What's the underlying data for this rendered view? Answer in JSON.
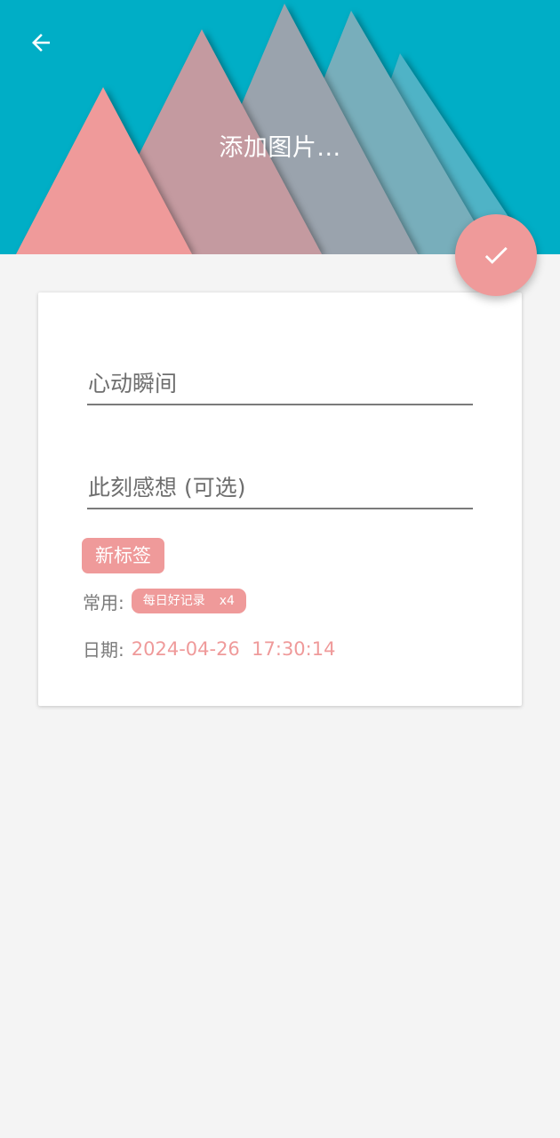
{
  "header": {
    "title": "添加图片...",
    "background_color": "#00aec6"
  },
  "icons": {
    "back": "arrow-left-icon",
    "confirm": "check-icon"
  },
  "colors": {
    "accent": "#ef9a9a",
    "page_background": "#f4f4f4",
    "card_background": "#ffffff"
  },
  "form": {
    "title_placeholder": "心动瞬间",
    "thoughts_placeholder": "此刻感想 (可选)",
    "new_tag_label": "新标签",
    "common_label": "常用:",
    "common_tags": [
      {
        "name": "每日好记录",
        "count": "x4"
      }
    ],
    "date_label": "日期:",
    "date_value": "2024-04-26  17:30:14"
  }
}
